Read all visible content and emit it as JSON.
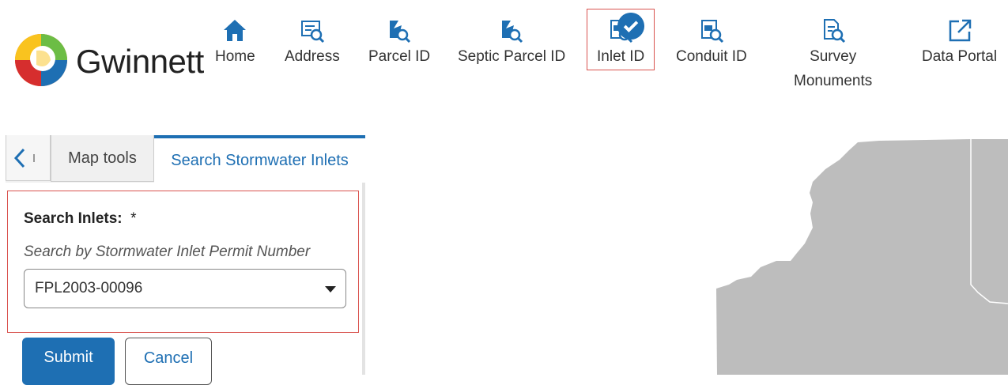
{
  "header": {
    "brand": "Gwinnett",
    "nav": [
      {
        "label": "Home",
        "icon": "home-icon"
      },
      {
        "label": "Address",
        "icon": "address-search-icon"
      },
      {
        "label": "Parcel ID",
        "icon": "parcel-search-icon"
      },
      {
        "label": "Septic Parcel ID",
        "icon": "parcel-search-icon"
      },
      {
        "label": "Inlet ID",
        "icon": "id-search-icon",
        "active": true
      },
      {
        "label": "Conduit ID",
        "icon": "id-search-icon"
      },
      {
        "label": "Survey\nMonuments",
        "icon": "document-search-icon"
      },
      {
        "label": "Data Portal",
        "icon": "external-link-icon"
      }
    ]
  },
  "panel": {
    "tabs": {
      "map_tools": "Map tools",
      "search": "Search Stormwater Inlets"
    },
    "form": {
      "label": "Search Inlets:",
      "required_mark": "*",
      "hint": "Search by Stormwater Inlet Permit Number",
      "select_value": "FPL2003-00096"
    },
    "buttons": {
      "submit": "Submit",
      "cancel": "Cancel"
    }
  },
  "colors": {
    "accent": "#1e6fb3",
    "highlight": "#d9534f",
    "map_fill": "#bdbdbd"
  }
}
